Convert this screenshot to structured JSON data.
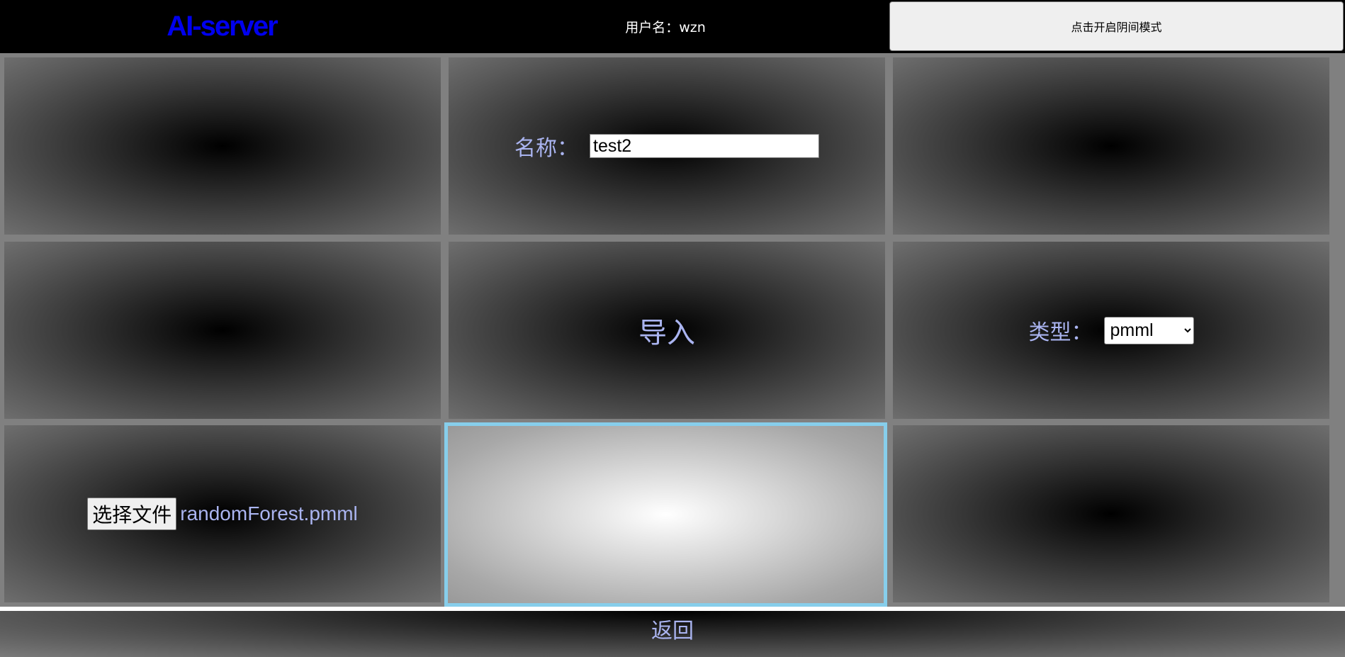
{
  "header": {
    "logo": "AI-server",
    "username": "用户名：wzn",
    "dark_mode_button": "点击开启阴间模式"
  },
  "form": {
    "name_label": "名称：",
    "name_value": "test2",
    "title": "导入",
    "type_label": "类型：",
    "type_options": [
      "pmml"
    ],
    "type_selected": "pmml",
    "file_button": "选择文件",
    "file_name": "randomForest.pmml"
  },
  "footer": {
    "back_label": "返回"
  },
  "colors": {
    "logo": "#0000ee",
    "label": "#aab4f0",
    "highlight_border": "#87ceeb"
  }
}
